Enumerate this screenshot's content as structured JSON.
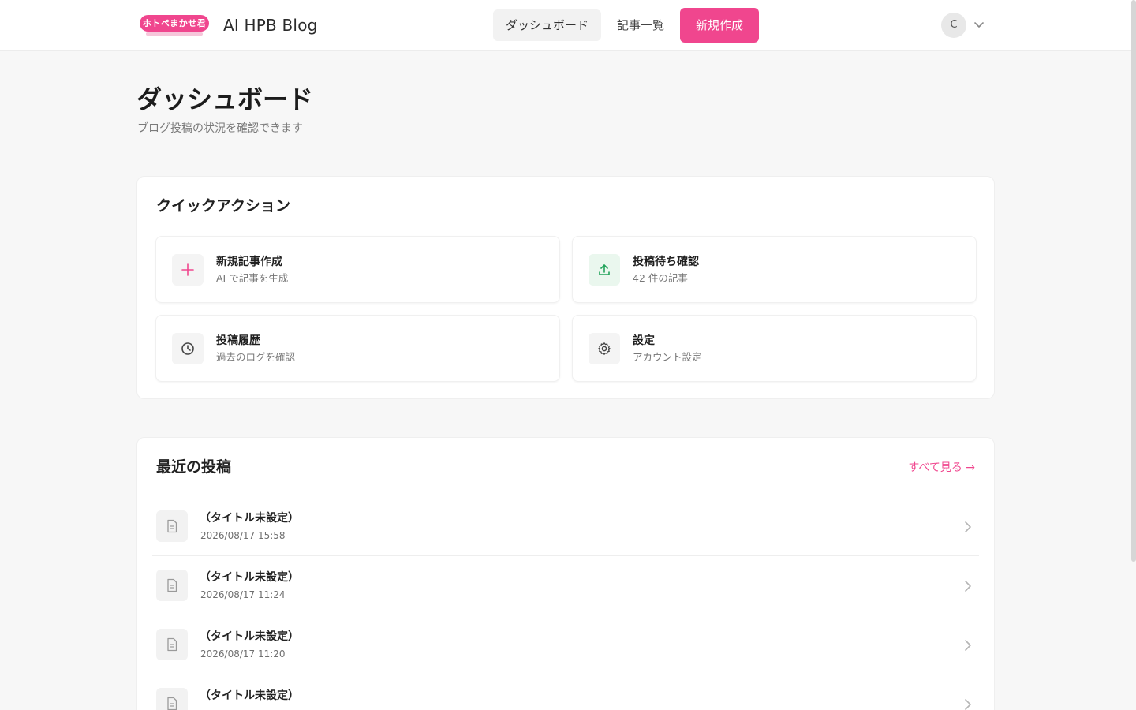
{
  "header": {
    "logo_text": "ホトペまかせ君",
    "brand": "AI HPB Blog",
    "nav": {
      "dashboard": "ダッシュボード",
      "articles": "記事一覧",
      "new": "新規作成"
    },
    "user_initial": "C"
  },
  "page": {
    "title": "ダッシュボード",
    "subtitle": "ブログ投稿の状況を確認できます"
  },
  "quick_actions": {
    "title": "クイックアクション",
    "items": [
      {
        "title": "新規記事作成",
        "desc": "AI で記事を生成",
        "icon": "plus-icon"
      },
      {
        "title": "投稿待ち確認",
        "desc": "42 件の記事",
        "icon": "upload-icon"
      },
      {
        "title": "投稿履歴",
        "desc": "過去のログを確認",
        "icon": "clock-icon"
      },
      {
        "title": "設定",
        "desc": "アカウント設定",
        "icon": "gear-icon"
      }
    ]
  },
  "recent": {
    "title": "最近の投稿",
    "see_all": "すべて見る →",
    "posts": [
      {
        "title": "（タイトル未設定）",
        "date": "2026/08/17 15:58"
      },
      {
        "title": "（タイトル未設定）",
        "date": "2026/08/17 11:24"
      },
      {
        "title": "（タイトル未設定）",
        "date": "2026/08/17 11:20"
      },
      {
        "title": "（タイトル未設定）",
        "date": ""
      }
    ]
  },
  "colors": {
    "accent": "#f0468e",
    "success": "#22a35a"
  }
}
